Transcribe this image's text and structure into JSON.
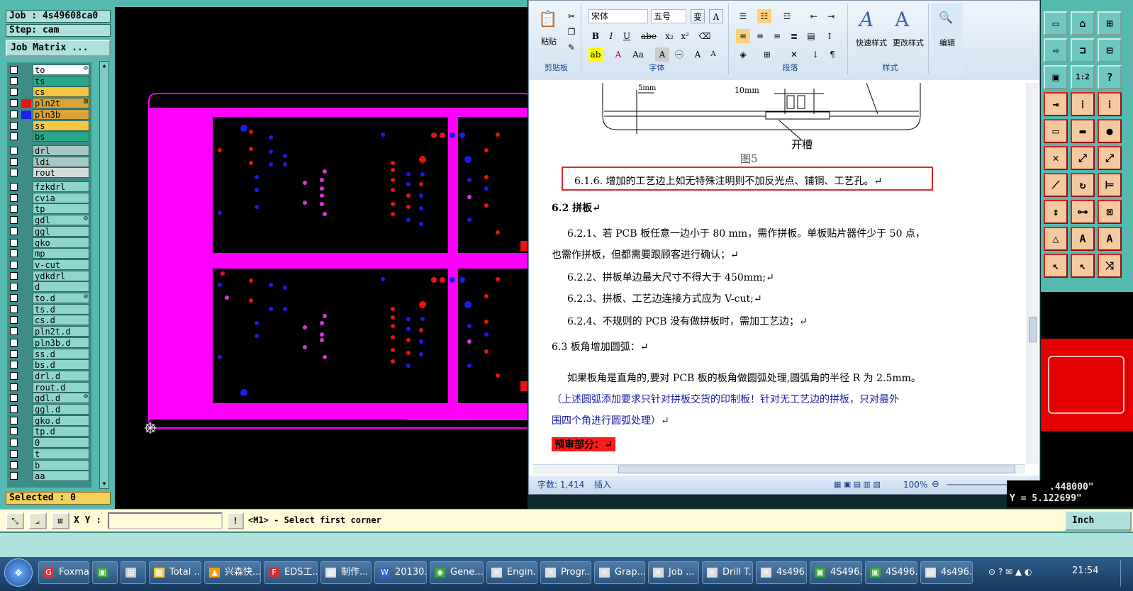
{
  "left_panel": {
    "job": "Job : 4s49608ca0",
    "step": "Step: cam",
    "job_matrix": "Job Matrix ...",
    "selected": "Selected : 0",
    "layers": [
      {
        "name": "to",
        "color": "#ffffff",
        "marker": "⊘",
        "swatch": ""
      },
      {
        "name": "ts",
        "color": "#2aa58a",
        "marker": "",
        "swatch": ""
      },
      {
        "name": "cs",
        "color": "#f6c542",
        "marker": "",
        "swatch": ""
      },
      {
        "name": "pln2t",
        "color": "#d8a43a",
        "marker": "⊞",
        "swatch": "#ee1111"
      },
      {
        "name": "pln3b",
        "color": "#d8a43a",
        "marker": "",
        "swatch": "#1a22ee"
      },
      {
        "name": "ss",
        "color": "#f6c542",
        "marker": "",
        "swatch": ""
      },
      {
        "name": "bs",
        "color": "#2aa58a",
        "marker": "",
        "swatch": ""
      },
      {
        "name": "drl",
        "color": "#a8c6c4",
        "marker": "",
        "swatch": ""
      },
      {
        "name": "ldi",
        "color": "#a8c6c4",
        "marker": "",
        "swatch": ""
      },
      {
        "name": "rout",
        "color": "#d6dcdc",
        "marker": "",
        "swatch": ""
      },
      {
        "name": "fzkdrl",
        "color": "#8fd4cd",
        "marker": "",
        "swatch": ""
      },
      {
        "name": "cvia",
        "color": "#8fd4cd",
        "marker": "",
        "swatch": ""
      },
      {
        "name": "tp",
        "color": "#8fd4cd",
        "marker": "",
        "swatch": ""
      },
      {
        "name": "gdl",
        "color": "#8fd4cd",
        "marker": "⊘",
        "swatch": ""
      },
      {
        "name": "ggl",
        "color": "#8fd4cd",
        "marker": "",
        "swatch": ""
      },
      {
        "name": "gko",
        "color": "#8fd4cd",
        "marker": "",
        "swatch": ""
      },
      {
        "name": "mp",
        "color": "#8fd4cd",
        "marker": "",
        "swatch": ""
      },
      {
        "name": "v-cut",
        "color": "#8fd4cd",
        "marker": "",
        "swatch": ""
      },
      {
        "name": "ydkdrl",
        "color": "#8fd4cd",
        "marker": "",
        "swatch": ""
      },
      {
        "name": "d",
        "color": "#8fd4cd",
        "marker": "",
        "swatch": ""
      },
      {
        "name": "to.d",
        "color": "#8fd4cd",
        "marker": "⊘",
        "swatch": ""
      },
      {
        "name": "ts.d",
        "color": "#8fd4cd",
        "marker": "",
        "swatch": ""
      },
      {
        "name": "cs.d",
        "color": "#8fd4cd",
        "marker": "",
        "swatch": ""
      },
      {
        "name": "pln2t.d",
        "color": "#8fd4cd",
        "marker": "",
        "swatch": ""
      },
      {
        "name": "pln3b.d",
        "color": "#8fd4cd",
        "marker": "",
        "swatch": ""
      },
      {
        "name": "ss.d",
        "color": "#8fd4cd",
        "marker": "",
        "swatch": ""
      },
      {
        "name": "bs.d",
        "color": "#8fd4cd",
        "marker": "",
        "swatch": ""
      },
      {
        "name": "drl.d",
        "color": "#8fd4cd",
        "marker": "",
        "swatch": ""
      },
      {
        "name": "rout.d",
        "color": "#8fd4cd",
        "marker": "",
        "swatch": ""
      },
      {
        "name": "gdl.d",
        "color": "#8fd4cd",
        "marker": "⊘",
        "swatch": ""
      },
      {
        "name": "ggl.d",
        "color": "#8fd4cd",
        "marker": "",
        "swatch": ""
      },
      {
        "name": "gko.d",
        "color": "#8fd4cd",
        "marker": "",
        "swatch": ""
      },
      {
        "name": "tp.d",
        "color": "#8fd4cd",
        "marker": "",
        "swatch": ""
      },
      {
        "name": "0",
        "color": "#8fd4cd",
        "marker": "",
        "swatch": ""
      },
      {
        "name": "t",
        "color": "#8fd4cd",
        "marker": "",
        "swatch": ""
      },
      {
        "name": "b",
        "color": "#8fd4cd",
        "marker": "",
        "swatch": ""
      },
      {
        "name": "aa",
        "color": "#8fd4cd",
        "marker": "",
        "swatch": ""
      }
    ]
  },
  "colors": {
    "board": "#ff00ff",
    "pad_blue": "#1a1aee",
    "pad_red": "#ee1111",
    "pad_magenta": "#dd33dd"
  },
  "word": {
    "ribbon": {
      "clipboard_label": "剪贴板",
      "paste": "粘贴",
      "font_label": "字体",
      "font_name": "宋体",
      "font_size": "五号",
      "paragraph_label": "段落",
      "styles_label": "样式",
      "quick_style": "快速样式",
      "change_style": "更改样式",
      "edit": "编辑"
    },
    "figure": {
      "dim1": "5mm",
      "dim2": "10mm",
      "slot": "开槽",
      "caption": "图5"
    },
    "doc": {
      "highlight": "6.1.6. 增加的工艺边上如无特殊注明则不加反光点、铺铜、工艺孔。↵",
      "h62": "6.2 拼板↵",
      "p621a": "6.2.1、若 PCB 板任意一边小于 80 mm，需作拼板。单板贴片器件少于 50 点，",
      "p621b": "也需作拼板，但都需要跟顾客进行确认；↵",
      "p622": "6.2.2、拼板单边最大尺寸不得大于 450mm;↵",
      "p623": "6.2.3、拼板、工艺边连接方式应为 V-cut;↵",
      "p624": "6.2.4、不规则的 PCB 没有做拼板时，需加工艺边；↵",
      "h63": "6.3 板角增加圆弧：↵",
      "p63a": "如果板角是直角的,要对 PCB 板的板角做圆弧处理,圆弧角的半径 R 为 2.5mm。",
      "p63b": "（上述圆弧添加要求只针对拼板交货的印制板！针对无工艺边的拼板，只对最外",
      "p63c": "围四个角进行圆弧处理）↵",
      "pre": "预审部分：↵"
    },
    "status": {
      "words": "字数: 1,414",
      "mode": "插入",
      "zoom": "100%"
    }
  },
  "coords": {
    "x": ".448000\"",
    "y": "Y = 5.122699\""
  },
  "command": {
    "xy_label": "X Y :",
    "prompt": "<M1> - Select first corner",
    "units": "Inch"
  },
  "taskbar": [
    {
      "label": "Foxmail",
      "icon": "G",
      "color": "#d33"
    },
    {
      "label": "",
      "icon": "▣",
      "color": "#3a3"
    },
    {
      "label": "",
      "icon": "▤",
      "color": "#ccc"
    },
    {
      "label": "Total ...",
      "icon": "▦",
      "color": "#fc3"
    },
    {
      "label": "兴森快...",
      "icon": "▲",
      "color": "#f90"
    },
    {
      "label": "EDS工...",
      "icon": "F",
      "color": "#c33"
    },
    {
      "label": "制作...",
      "icon": "▤",
      "color": "#ddd"
    },
    {
      "label": "20130...",
      "icon": "W",
      "color": "#36c"
    },
    {
      "label": "Gene...",
      "icon": "◉",
      "color": "#3a3"
    },
    {
      "label": "Engin...",
      "icon": "✕",
      "color": "#ddd"
    },
    {
      "label": "Progr...",
      "icon": "✕",
      "color": "#ddd"
    },
    {
      "label": "Grap...",
      "icon": "✕",
      "color": "#ddd"
    },
    {
      "label": "Job ...",
      "icon": "✕",
      "color": "#ddd"
    },
    {
      "label": "Drill T...",
      "icon": "✕",
      "color": "#ddd"
    },
    {
      "label": "4s496...",
      "icon": "✕",
      "color": "#ddd"
    },
    {
      "label": "4S496...",
      "icon": "▣",
      "color": "#3a3"
    },
    {
      "label": "4S496...",
      "icon": "▣",
      "color": "#3a3"
    },
    {
      "label": "4s496...",
      "icon": "▤",
      "color": "#ddd"
    }
  ],
  "clock": "21:54"
}
